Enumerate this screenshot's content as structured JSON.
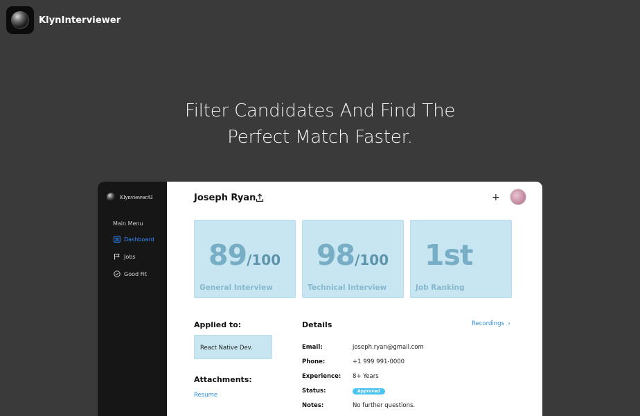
{
  "brand": {
    "name": "KlynInterviewer",
    "logo_icon": "orb-icon"
  },
  "hero": {
    "line1": "Filter Candidates And Find The",
    "line2": "Perfect Match Faster."
  },
  "app": {
    "sidebar": {
      "brand_name": "KlynviewerAI",
      "menu_title": "Main Menu",
      "items": [
        {
          "label": "Dashboard",
          "icon": "dashboard-icon",
          "active": true
        },
        {
          "label": "Jobs",
          "icon": "flag-icon",
          "active": false
        },
        {
          "label": "Good Fit",
          "icon": "check-circle-icon",
          "active": false
        }
      ]
    },
    "header": {
      "candidate_name": "Joseph Ryan",
      "plus_label": "+"
    },
    "cards": [
      {
        "value": "89",
        "suffix": "/100",
        "label": "General Interview"
      },
      {
        "value": "98",
        "suffix": "/100",
        "label": "Technical Interview"
      },
      {
        "value": "1st",
        "suffix": "",
        "label": "Job Ranking"
      }
    ],
    "applied": {
      "title": "Applied to:",
      "role": "React Native Dev."
    },
    "attachments": {
      "title": "Attachments:",
      "link": "Resume"
    },
    "details": {
      "title": "Details",
      "recordings_label": "Recordings",
      "rows": [
        {
          "key": "Email:",
          "value": "joseph.ryan@gmail.com"
        },
        {
          "key": "Phone:",
          "value": "+1 999 991-0000"
        },
        {
          "key": "Experience:",
          "value": "8+ Years"
        },
        {
          "key": "Status:",
          "value": "Approved"
        },
        {
          "key": "Notes:",
          "value": "No further questions."
        }
      ]
    }
  },
  "colors": {
    "active": "#2f8cff",
    "card_bg": "#c7e6f2",
    "badge": "#49c3f0",
    "link": "#2a8de0"
  }
}
